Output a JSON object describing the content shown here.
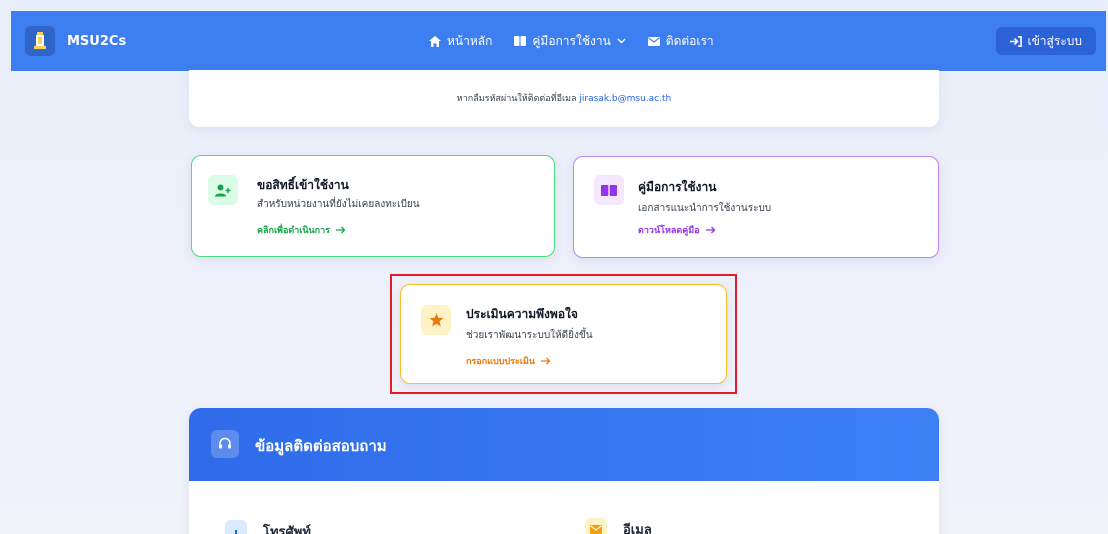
{
  "navbar": {
    "brand": "MSU2Cs",
    "menu": [
      {
        "label": "หน้าหลัก",
        "icon": "home-icon"
      },
      {
        "label": "คู่มือการใช้งาน",
        "icon": "book-icon"
      },
      {
        "label": "ติดต่อเรา",
        "icon": "mail-icon"
      }
    ],
    "login_label": "เข้าสู่ระบบ"
  },
  "top_card": {
    "text": "หากลืมรหัสผ่านให้ติดต่อที่อีเมล",
    "email": "jirasak.b@msu.ac.th"
  },
  "cards": {
    "access": {
      "title": "ขอสิทธิ์เข้าใช้งาน",
      "desc": "สำหรับหน่วยงานที่ยังไม่เคยลงทะเบียน",
      "link": "คลิกเพื่อดำเนินการ"
    },
    "manual": {
      "title": "คู่มือการใช้งาน",
      "desc": "เอกสารแนะนำการใช้งานระบบ",
      "link": "ดาวน์โหลดคู่มือ"
    },
    "rate": {
      "title": "ประเมินความพึงพอใจ",
      "desc": "ช่วยเราพัฒนาระบบให้ดียิ่งขึ้น",
      "link": "กรอกแบบประเมิน"
    }
  },
  "contact": {
    "title": "ข้อมูลติดต่อสอบถาม",
    "phone_label": "โทรศัพท์",
    "email_label": "อีเมล"
  },
  "colors": {
    "primary": "#3d7ef0",
    "green": "#16a34a",
    "purple": "#9333ea",
    "orange": "#ea7a0c",
    "highlight": "#e11d2a"
  }
}
